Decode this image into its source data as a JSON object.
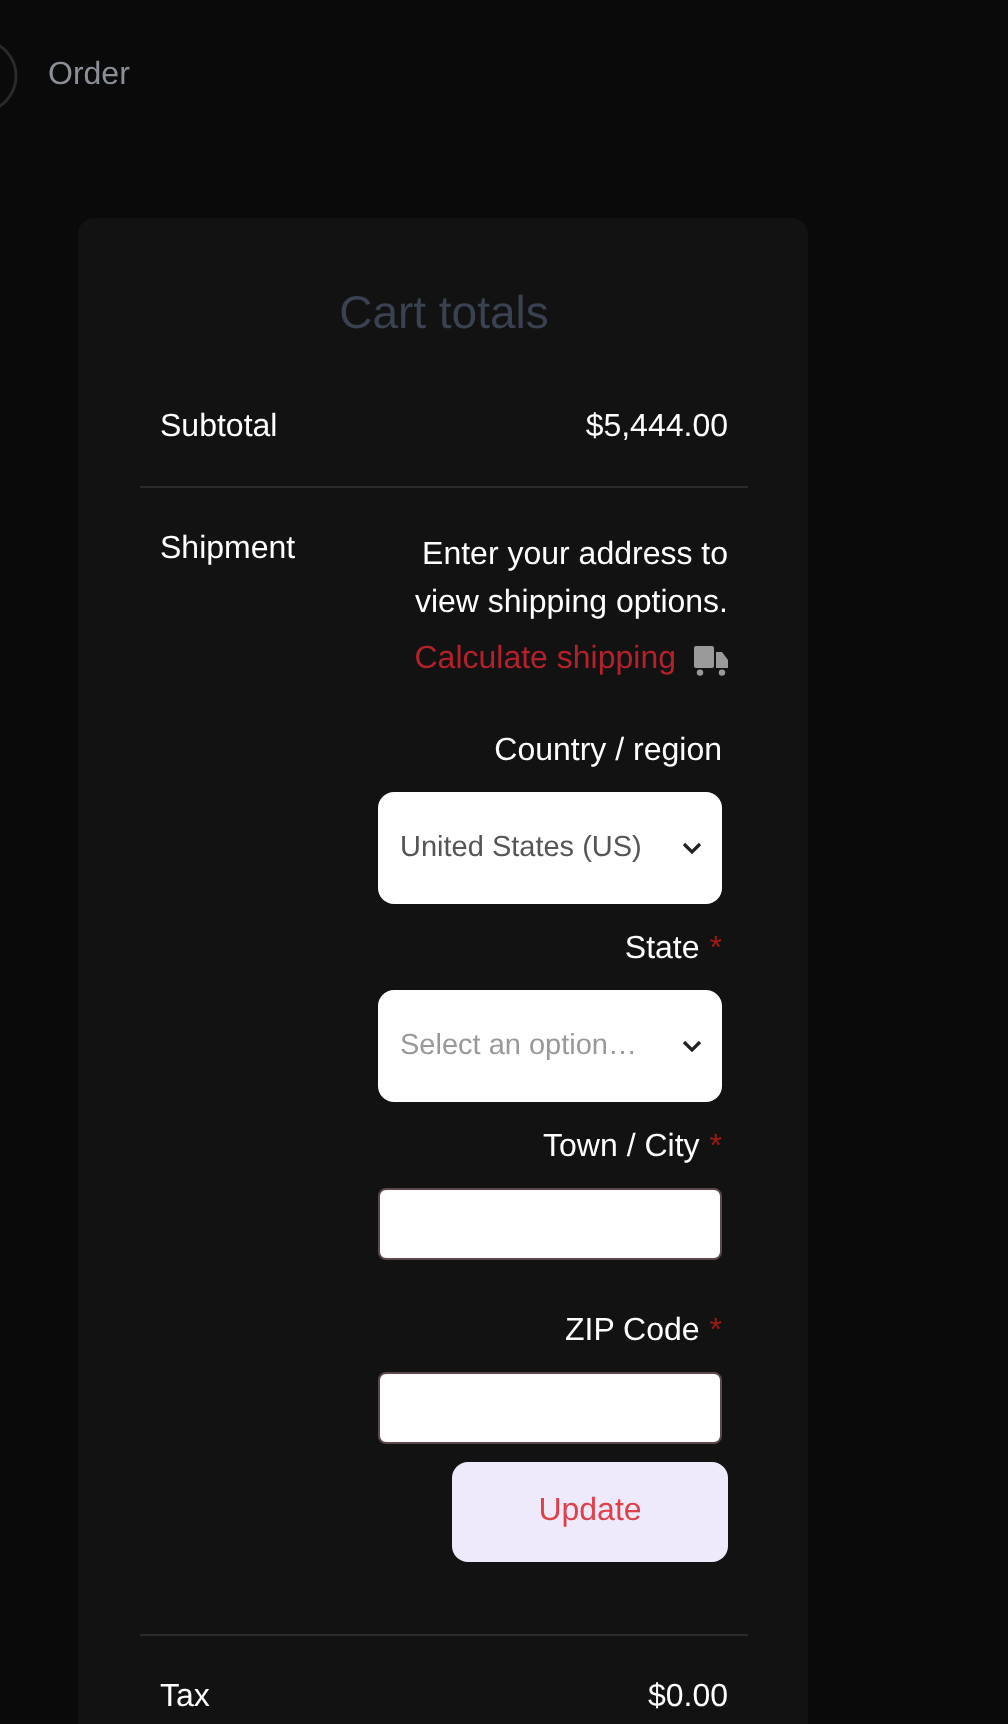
{
  "breadcrumb": {
    "label": "Order"
  },
  "card": {
    "title": "Cart totals",
    "subtotal": {
      "label": "Subtotal",
      "value": "$5,444.00"
    },
    "shipment": {
      "label": "Shipment",
      "note": "Enter your address to view shipping options.",
      "calculate_link": "Calculate shipping",
      "fields": [
        {
          "kind": "select",
          "label": "Country / region",
          "value": "United States (US)"
        },
        {
          "kind": "select",
          "label": "State",
          "required_mark": "*",
          "placeholder": "Select an option…"
        },
        {
          "kind": "text",
          "label": "Town / City",
          "required_mark": "*"
        },
        {
          "kind": "text",
          "label": "ZIP Code",
          "required_mark": "*"
        }
      ],
      "button": "Update"
    },
    "tax": {
      "label": "Tax",
      "value": "$0.00"
    }
  }
}
